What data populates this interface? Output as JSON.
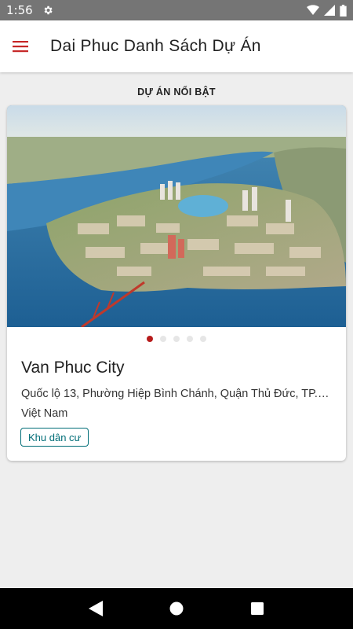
{
  "status_bar": {
    "time": "1:56",
    "icons": [
      "gear-icon",
      "wifi-icon",
      "signal-icon",
      "battery-icon"
    ]
  },
  "app_bar": {
    "title": "Dai Phuc Danh Sách Dự Án",
    "menu_icon": "hamburger-menu-icon",
    "accent_color": "#c62828"
  },
  "featured": {
    "section_title": "DỰ ÁN NỔI BẬT",
    "carousel": {
      "total": 5,
      "active_index": 0
    },
    "project": {
      "name": "Van Phuc City",
      "address": "Quốc lộ 13, Phường Hiệp Bình Chánh, Quận Thủ Đức, TP.…",
      "country": "Việt Nam",
      "tag": "Khu dân cư",
      "image": "aerial-city-river-image"
    }
  },
  "nav_bar": {
    "icons": [
      "back-triangle-icon",
      "home-circle-icon",
      "recents-square-icon"
    ]
  }
}
